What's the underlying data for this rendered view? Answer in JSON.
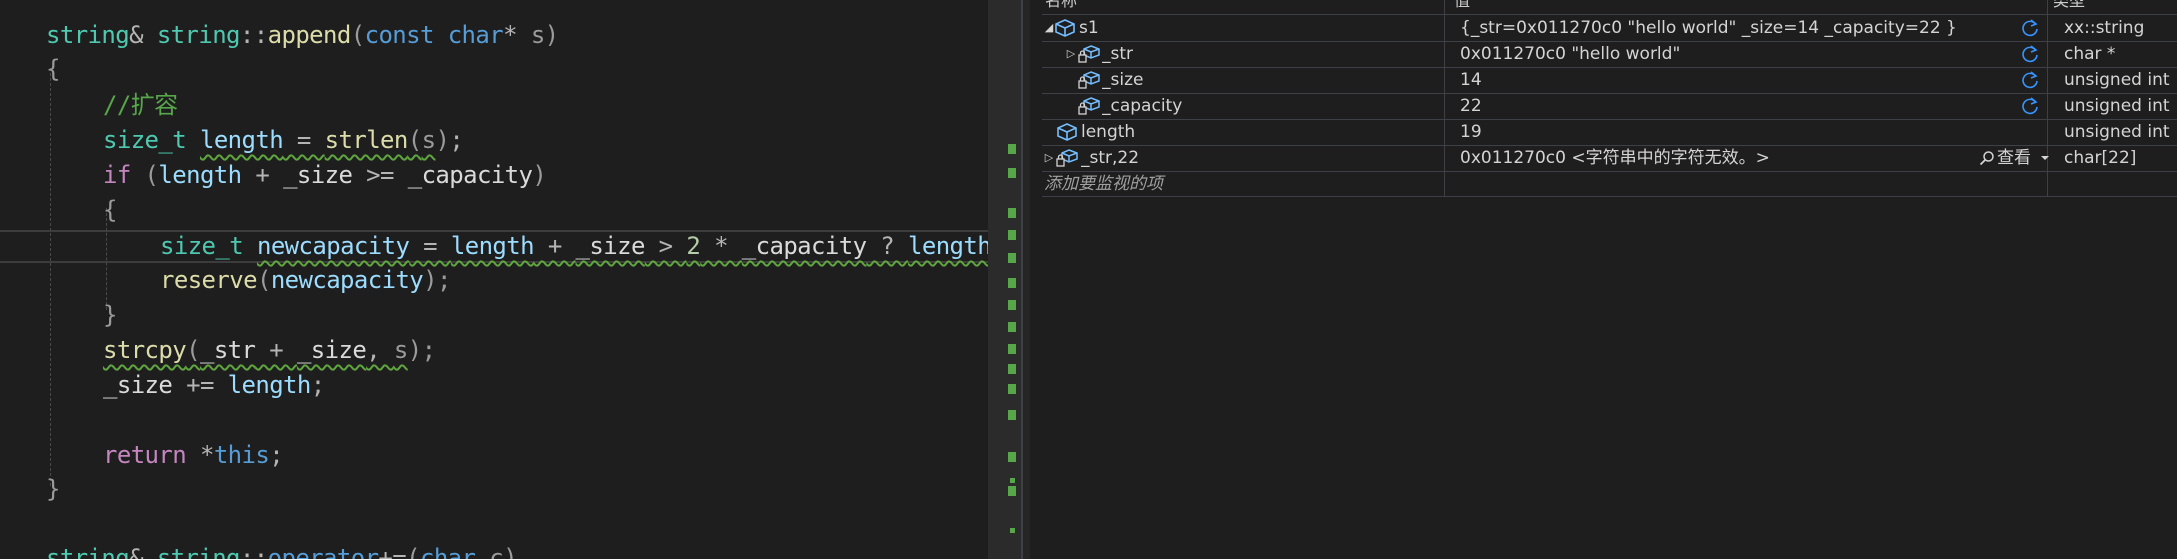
{
  "editor": {
    "line1": {
      "t1": "string",
      "t2": "& ",
      "t3": "string",
      "t4": "::",
      "t5": "append",
      "t6": "(",
      "t7": "const",
      "t8": " ",
      "t9": "char",
      "t10": "* ",
      "t11": "s",
      "t12": ")"
    },
    "line2": "{",
    "line3": "//扩容",
    "line4": {
      "t1": "size_t",
      "t2": " ",
      "t3": "length",
      "t4": " = ",
      "t5": "strlen",
      "t6": "(",
      "t7": "s",
      "t8": ")",
      "t9": ";"
    },
    "line5": {
      "t1": "if",
      "t2": " (",
      "t3": "length",
      "t4": " + ",
      "t5": "_size",
      "t6": " >= ",
      "t7": "_capacity",
      "t8": ")"
    },
    "line6": "{",
    "line7": {
      "t1": "size_t",
      "t2": " ",
      "t3": "newcapacity",
      "t4": " = ",
      "t5": "length",
      "t6": " + ",
      "t7": "_size",
      "t8": " > ",
      "t9": "2",
      "t10": " * ",
      "t11": "_capacity",
      "t12": " ? ",
      "t13": "length"
    },
    "line8": {
      "t1": "reserve",
      "t2": "(",
      "t3": "newcapacity",
      "t4": ");"
    },
    "line9": "}",
    "line10": {
      "t1": "strcpy",
      "t2": "(",
      "t3": "_str",
      "t4": " + ",
      "t5": "_size",
      "t6": ", ",
      "t7": "s",
      "t8": ");"
    },
    "line11": {
      "t1": "_size",
      "t2": " += ",
      "t3": "length",
      "t4": ";"
    },
    "line13": {
      "t1": "return",
      "t2": " *",
      "t3": "this",
      "t4": ";"
    },
    "line14": "}",
    "line16": {
      "t1": "string",
      "t2": "& ",
      "t3": "string",
      "t4": "::",
      "t5": "operator",
      "t6": "+=",
      "t7": "(",
      "t8": "char",
      "t9": " ",
      "t10": "c",
      "t11": ")"
    }
  },
  "watch": {
    "headers": {
      "name": "名称",
      "value": "值",
      "type": "类型"
    },
    "rows": [
      {
        "name": "s1",
        "value": "{_str=0x011270c0 \"hello world\" _size=14 _capacity=22 }",
        "type": "xx::string",
        "expander": "◢"
      },
      {
        "name": "_str",
        "value": "0x011270c0 \"hello world\"",
        "type": "char *",
        "expander": "▷"
      },
      {
        "name": "_size",
        "value": "14",
        "type": "unsigned int"
      },
      {
        "name": "_capacity",
        "value": "22",
        "type": "unsigned int"
      },
      {
        "name": "length",
        "value": "19",
        "type": "unsigned int"
      },
      {
        "name": "_str,22",
        "value": "0x011270c0 <字符串中的字符无效。>",
        "type": "char[22]",
        "expander": "▷",
        "view_label": "查看"
      }
    ],
    "add_item_placeholder": "添加要监视的项"
  },
  "colors": {
    "background": "#1e1e1e",
    "keyword": "#569cd6",
    "type": "#4ec9b0",
    "function": "#dcdcaa",
    "variable": "#9cdcfe",
    "comment": "#57a64a",
    "control": "#c586c0",
    "number": "#b5cea8",
    "squiggle": "#5fa53f",
    "refresh_icon": "#3794ff"
  },
  "icons": {
    "field": "variable-field-icon",
    "locked_field": "private-field-icon",
    "refresh": "refresh-icon",
    "search": "magnifier-icon",
    "dropdown": "dropdown-arrow-icon"
  }
}
